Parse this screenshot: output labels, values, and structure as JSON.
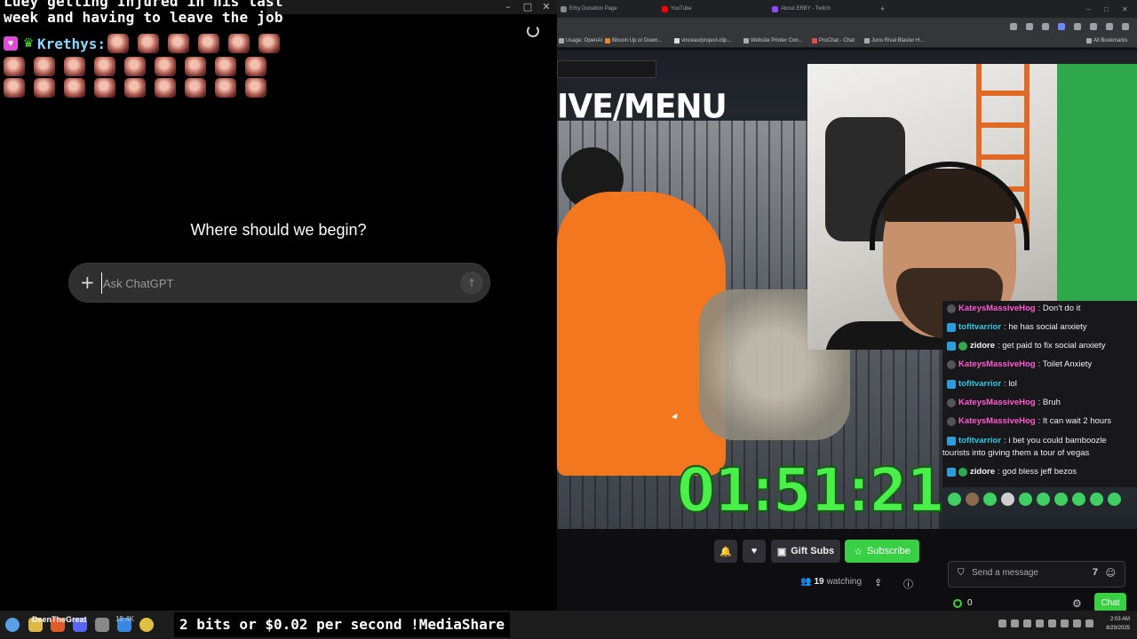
{
  "overlay": {
    "line_cut": "Luey getting Injured in his last",
    "line_two": "week and having to leave the job",
    "username": "Krethys:"
  },
  "chatgpt": {
    "heading": "Where should we begin?",
    "placeholder": "Ask ChatGPT"
  },
  "browser": {
    "tabs": [
      "Erby Donation Page",
      "YouTube",
      "About ERBY - Twitch"
    ],
    "bookmarks": [
      "Usage: OpenAI",
      "Bitcoin Up or Down...",
      "vinceau/project-clip...",
      "Website Printer Con...",
      "ProChat - Chat",
      "Juno Rival Blaster H..."
    ],
    "all_bookmarks": "All Bookmarks"
  },
  "stream": {
    "banner": "IVE/MENU",
    "timer": "01:51:21",
    "watching_count": "19",
    "watching_label": "watching"
  },
  "chat": {
    "messages": [
      {
        "user": "KateysMassiveHog",
        "text": ": Don't do it",
        "color": "pink",
        "badge": "gray"
      },
      {
        "user": "tofitvarrior",
        "text": ": he has social anxiety",
        "color": "cyan",
        "badge": "blue"
      },
      {
        "user": "zidore",
        "text": ": get paid to fix social anxiety",
        "color": "white",
        "badge": "green"
      },
      {
        "user": "KateysMassiveHog",
        "text": ": Toilet Anxiety",
        "color": "pink",
        "badge": "gray"
      },
      {
        "user": "tofitvarrior",
        "text": ": lol",
        "color": "cyan",
        "badge": "blue"
      },
      {
        "user": "KateysMassiveHog",
        "text": ": Bruh",
        "color": "pink",
        "badge": "gray"
      },
      {
        "user": "KateysMassiveHog",
        "text": ": It can wait 2 hours",
        "color": "pink",
        "badge": "gray"
      },
      {
        "user": "tofitvarrior",
        "text": ": i bet you could bamboozle",
        "color": "cyan",
        "badge": "blue"
      },
      {
        "user": "",
        "text": "tourists into giving them a tour of vegas",
        "color": "white",
        "badge": ""
      },
      {
        "user": "zidore",
        "text": ": god bless jeff bezos",
        "color": "white",
        "badge": "green"
      }
    ],
    "send_placeholder": "Send a message",
    "points": "0",
    "chat_button": "Chat"
  },
  "actions": {
    "gift_subs": "Gift Subs",
    "subscribe": "Subscribe"
  },
  "taskbar": {
    "streamer": "DeenTheGreat",
    "viewers": "19.4K",
    "ticker": "2 bits or $0.02 per second !MediaShare",
    "time": "2:03 AM",
    "date": "8/29/2025"
  },
  "colors": {
    "twitch_green": "#3ad046",
    "timer_green": "#49f04a",
    "chat_pink": "#ff5ad0",
    "chat_cyan": "#2ec8e6"
  }
}
